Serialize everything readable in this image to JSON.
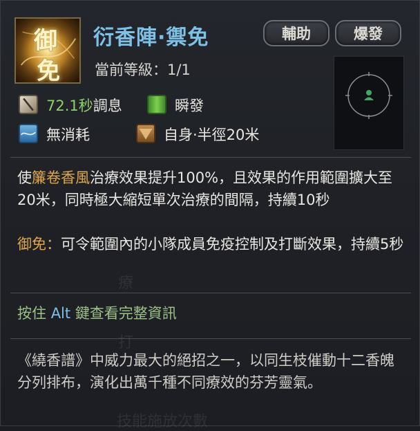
{
  "skill": {
    "name": "衍香陣·禦免",
    "level_label": "當前等級：1/1",
    "icon_glyph_top": "御",
    "icon_glyph_bottom": "免"
  },
  "tags": [
    "輔助",
    "爆發"
  ],
  "stats": {
    "cooldown_value": "72.1秒",
    "cooldown_label": "調息",
    "cast_type": "瞬發",
    "cost": "無消耗",
    "range": "自身·半徑20米"
  },
  "description": {
    "p1_prefix": "使",
    "p1_highlight": "簾卷香風",
    "p1_rest": "治療效果提升100%，且效果的作用範圍擴大至20米，同時極大縮短單次治療的間隔，持續10秒",
    "p2_label": "御免：",
    "p2_rest": "可令範圍內的小隊成員免疫控制及打斷效果，持續5秒"
  },
  "hint": {
    "prefix": "按住",
    "key": "Alt",
    "suffix": "鍵查看完整資訊"
  },
  "lore": "《繞香譜》中威力最大的絕招之一，以同生枝催動十二香魄分列排布，演化出萬千種不同療效的芬芳靈氣。",
  "colors": {
    "title": "#7ec1e6",
    "highlight": "#e0a74a",
    "green": "#8ed06a",
    "hint": "#9cc088",
    "key": "#7ec1e6",
    "range_marker": "#3ea86a"
  },
  "icons": {
    "cooldown": "hourglass-icon",
    "cast": "green-bar-icon",
    "cost": "wave-icon",
    "range": "triangle-range-icon"
  }
}
